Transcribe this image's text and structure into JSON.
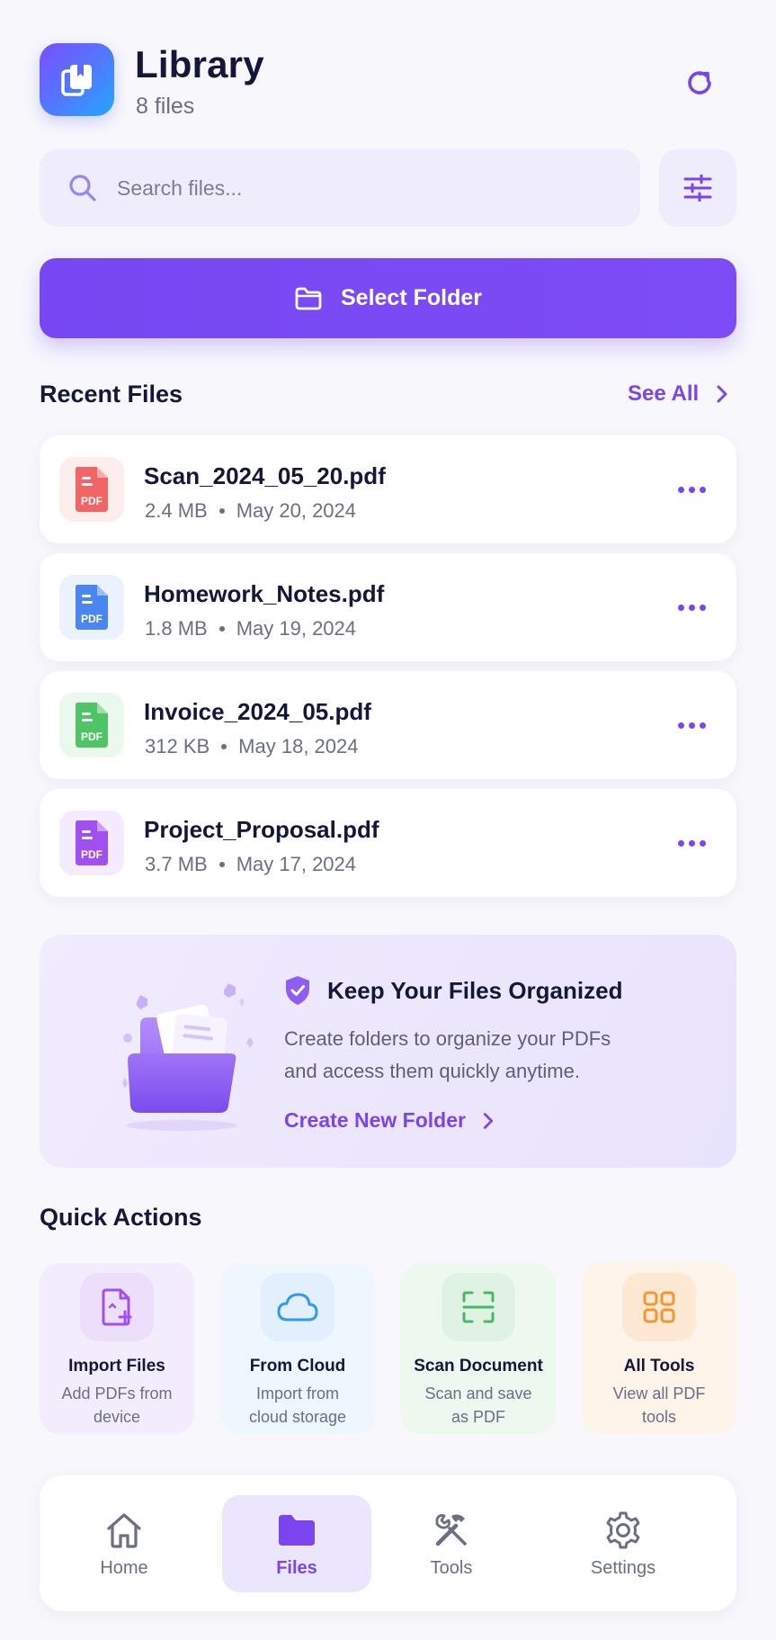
{
  "header": {
    "title": "Library",
    "subtitle": "8 files",
    "logo_icon": "bookmark-file-icon",
    "refresh_icon": "refresh-icon"
  },
  "search": {
    "placeholder": "Search files...",
    "value": "",
    "filter_icon": "sliders-icon"
  },
  "primary_action": {
    "label": "Select Folder",
    "icon": "folder-icon"
  },
  "recent": {
    "title": "Recent Files",
    "see_all": "See All",
    "files": [
      {
        "name": "Scan_2024_05_20.pdf",
        "size": "2.4 MB",
        "date": "May 20, 2024",
        "color": "#f16565",
        "bg": "#fdeeee",
        "badge": "PDF"
      },
      {
        "name": "Homework_Notes.pdf",
        "size": "1.8 MB",
        "date": "May 19, 2024",
        "color": "#4a86f0",
        "bg": "#ebf2fe",
        "badge": "PDF"
      },
      {
        "name": "Invoice_2024_05.pdf",
        "size": "312 KB",
        "date": "May 18, 2024",
        "color": "#4ec467",
        "bg": "#eaf8ed",
        "badge": "PDF"
      },
      {
        "name": "Project_Proposal.pdf",
        "size": "3.7 MB",
        "date": "May 17, 2024",
        "color": "#a14ff0",
        "bg": "#f4ebfe",
        "badge": "PDF"
      }
    ]
  },
  "promo": {
    "title": "Keep Your Files Organized",
    "text_line1": "Create folders to organize your PDFs",
    "text_line2": "and access them quickly anytime.",
    "link": "Create New Folder",
    "icon": "shield-check-icon"
  },
  "quick_actions": {
    "title": "Quick Actions",
    "items": [
      {
        "title": "Import Files",
        "desc_line1": "Add PDFs from",
        "desc_line2": "device",
        "icon": "file-plus-icon",
        "color": "#a14ff0",
        "bg": "#f3ecfd",
        "icon_bg": "#ebdffc"
      },
      {
        "title": "From Cloud",
        "desc_line1": "Import from",
        "desc_line2": "cloud storage",
        "icon": "cloud-icon",
        "color": "#2f9af0",
        "bg": "#eef6fe",
        "icon_bg": "#e2effd"
      },
      {
        "title": "Scan Document",
        "desc_line1": "Scan and save",
        "desc_line2": "as PDF",
        "icon": "scan-icon",
        "color": "#47b863",
        "bg": "#edf8ef",
        "icon_bg": "#dff2e4"
      },
      {
        "title": "All Tools",
        "desc_line1": "View all PDF",
        "desc_line2": "tools",
        "icon": "grid-icon",
        "color": "#f5952e",
        "bg": "#fef4ea",
        "icon_bg": "#fde8d3"
      }
    ]
  },
  "bottom_nav": {
    "items": [
      {
        "label": "Home",
        "icon": "home-icon",
        "active": false
      },
      {
        "label": "Files",
        "icon": "folder-icon",
        "active": true
      },
      {
        "label": "Tools",
        "icon": "tools-icon",
        "active": false
      },
      {
        "label": "Settings",
        "icon": "gear-icon",
        "active": false
      }
    ]
  }
}
